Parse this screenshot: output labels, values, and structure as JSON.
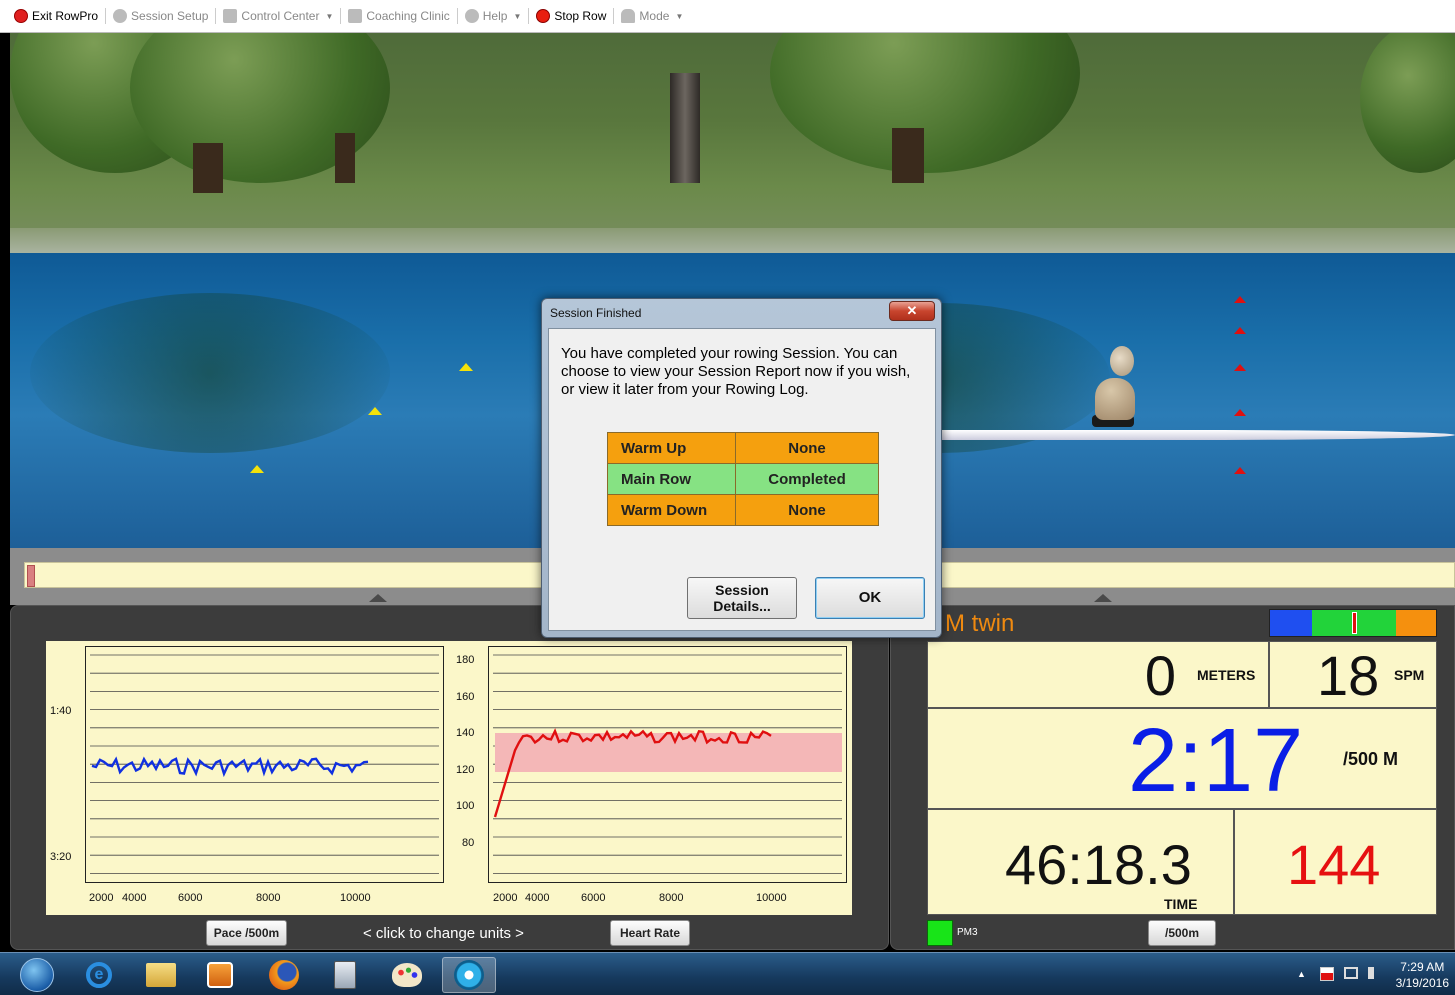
{
  "toolbar": {
    "items": [
      {
        "label": "Exit RowPro"
      },
      {
        "label": "Session Setup"
      },
      {
        "label": "Control Center"
      },
      {
        "label": "Coaching Clinic"
      },
      {
        "label": "Help"
      },
      {
        "label": "Stop Row"
      },
      {
        "label": "Mode"
      }
    ]
  },
  "dialog": {
    "title": "Session Finished",
    "close_glyph": "✕",
    "message": "You have completed your rowing Session.  You can choose to view your Session Report now if you wish, or view it later from your Rowing Log.",
    "stages": [
      {
        "name": "Warm Up",
        "status": "None",
        "color": "#f5a00e"
      },
      {
        "name": "Main Row",
        "status": "Completed",
        "color": "#86e283"
      },
      {
        "name": "Warm Down",
        "status": "None",
        "color": "#f5a00e"
      }
    ],
    "details_button": "Session Details...",
    "ok_button": "OK"
  },
  "pace_graph": {
    "y_ticks": [
      "1:40",
      "3:20"
    ],
    "x_ticks": [
      "2000",
      "4000",
      "6000",
      "8000",
      "10000"
    ],
    "button": "Pace /500m"
  },
  "hr_graph": {
    "y_ticks": [
      "180",
      "160",
      "140",
      "120",
      "100",
      "80"
    ],
    "x_ticks": [
      "2000",
      "4000",
      "6000",
      "8000",
      "10000"
    ],
    "button": "Heart Rate"
  },
  "units_hint": "<  click to change units  >",
  "monitor": {
    "title": "M twin",
    "meters": "0",
    "meters_unit": "METERS",
    "spm": "18",
    "spm_unit": "SPM",
    "pace": "2:17",
    "pace_unit": "/500 M",
    "time": "46:18.3",
    "time_unit": "TIME",
    "heart_rate": "144",
    "device_label": "PM3",
    "units_button": "/500m",
    "colors": {
      "pace": "#0a1ee6",
      "heart_rate": "#e61010",
      "title": "#f08a10"
    }
  },
  "taskbar": {
    "time": "7:29 AM",
    "date": "3/19/2016",
    "tray_arrow": "▲"
  }
}
